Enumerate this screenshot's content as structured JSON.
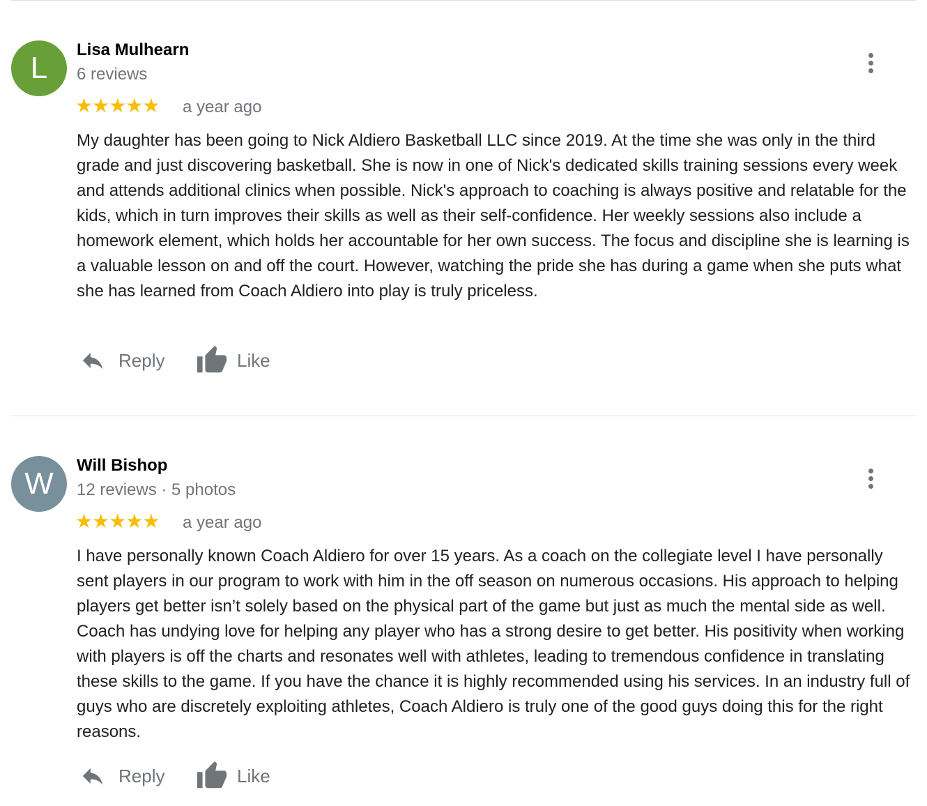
{
  "reviews": [
    {
      "avatar_letter": "L",
      "avatar_color": "#689f38",
      "name": "Lisa Mulhearn",
      "meta": "6 reviews",
      "stars": "★★★★★",
      "rating": 5,
      "time": "a year ago",
      "text": "My daughter has been going to Nick Aldiero Basketball LLC since 2019. At the time she was only in the third grade and just discovering basketball. She is now in one of Nick's dedicated skills training sessions every week and attends additional clinics when possible. Nick's approach to coaching is always positive and relatable for the kids, which  in turn improves their skills as well as their self-confidence. Her weekly sessions also include a homework element, which holds her accountable for her own success. The focus and discipline she is learning is a valuable lesson on and off the court. However, watching the pride she has during a game when she puts what she has learned from Coach Aldiero into play is truly priceless.",
      "reply_label": "Reply",
      "like_label": "Like"
    },
    {
      "avatar_letter": "W",
      "avatar_color": "#78909c",
      "name": "Will Bishop",
      "meta": "12 reviews · 5 photos",
      "stars": "★★★★★",
      "rating": 5,
      "time": "a year ago",
      "text": "I have personally known Coach Aldiero for over 15 years. As a coach on the collegiate level I have personally sent players in our program to work with him in the off season on numerous occasions. His approach to helping players get better isn’t solely based on the physical part of the game but just as much the mental side as well. Coach has undying love for helping any player who has a strong desire to get better. His positivity when working with players is off the charts and resonates well with athletes, leading to tremendous confidence in translating these skills to the game. If you have the chance it is highly recommended using his services. In an industry full of guys who are discretely exploiting athletes, Coach Aldiero is truly one of the good guys doing this for the right reasons.",
      "reply_label": "Reply",
      "like_label": "Like"
    }
  ],
  "icons": {
    "reply": "reply-icon",
    "like": "thumbs-up-icon",
    "more": "more-vertical-icon",
    "rating": "star-icon"
  },
  "colors": {
    "star": "#fbbc04",
    "secondary_text": "#70757a",
    "divider": "#e0e0e0"
  }
}
